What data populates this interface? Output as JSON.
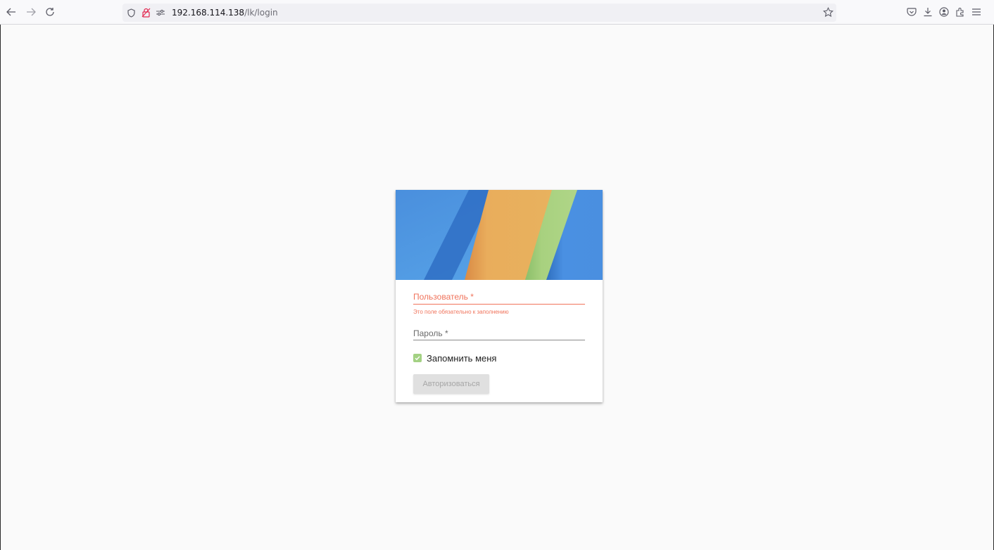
{
  "browser": {
    "url_host": "192.168.114.138",
    "url_path": "/lk/login",
    "nav_icons": [
      "back-arrow-icon",
      "forward-arrow-icon",
      "reload-icon"
    ],
    "url_icons": [
      "shield-icon",
      "insecure-lock-icon",
      "permissions-icon"
    ],
    "right_icons": [
      "pocket-icon",
      "downloads-icon",
      "account-icon",
      "extensions-icon",
      "menu-icon"
    ]
  },
  "login": {
    "username_label": "Пользователь *",
    "username_value": "",
    "username_error": "Это поле обязательно к заполнению",
    "password_label": "Пароль *",
    "password_value": "",
    "remember_label": "Запомнить меня",
    "remember_checked": true,
    "submit_label": "Авторизоваться",
    "submit_disabled": true
  },
  "colors": {
    "accent_error": "#f0735b",
    "checkbox": "#a3d183",
    "banner_blue": "#4a90e2",
    "banner_orange": "#e8ad5b",
    "banner_green": "#a8d07f"
  }
}
